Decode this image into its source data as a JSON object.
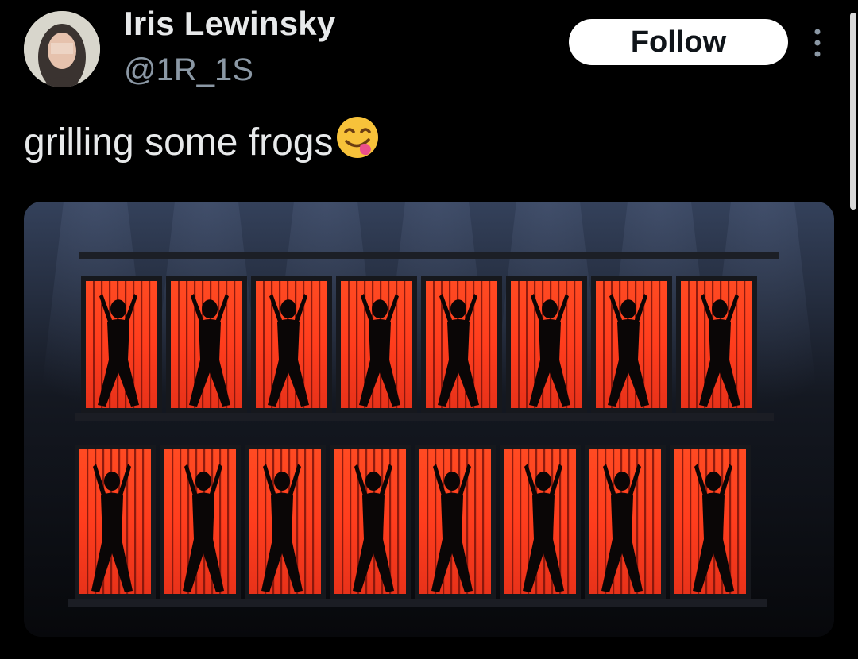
{
  "author": {
    "display_name": "Iris Lewinsky",
    "handle": "@1R_1S",
    "avatar_icon": "profile-avatar"
  },
  "actions": {
    "follow_label": "Follow",
    "more_icon": "more-vertical-icon"
  },
  "tweet": {
    "text": "grilling some frogs",
    "emoji": "face-savoring-food"
  },
  "media": {
    "description_icon": "stage-photo",
    "colors": {
      "panel": "#ff3b1c",
      "panel_glow": "#ff5a2e",
      "frame": "#1a1a1f",
      "sky": "#2c3850"
    }
  }
}
